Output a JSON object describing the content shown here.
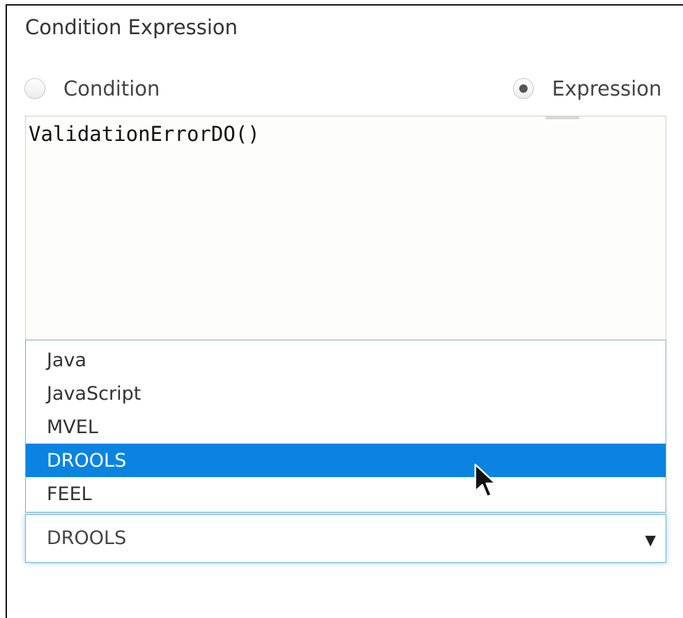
{
  "section": {
    "title": "Condition Expression"
  },
  "radios": {
    "condition_label": "Condition",
    "expression_label": "Expression",
    "selected": "Expression"
  },
  "editor": {
    "text": "ValidationErrorDO()"
  },
  "dropdown": {
    "options": [
      "Java",
      "JavaScript",
      "MVEL",
      "DROOLS",
      "FEEL"
    ],
    "highlighted": "DROOLS"
  },
  "select": {
    "value": "DROOLS",
    "caret_icon": "▼"
  },
  "colors": {
    "highlight": "#0a84e0",
    "focus_border": "#66afe9"
  }
}
